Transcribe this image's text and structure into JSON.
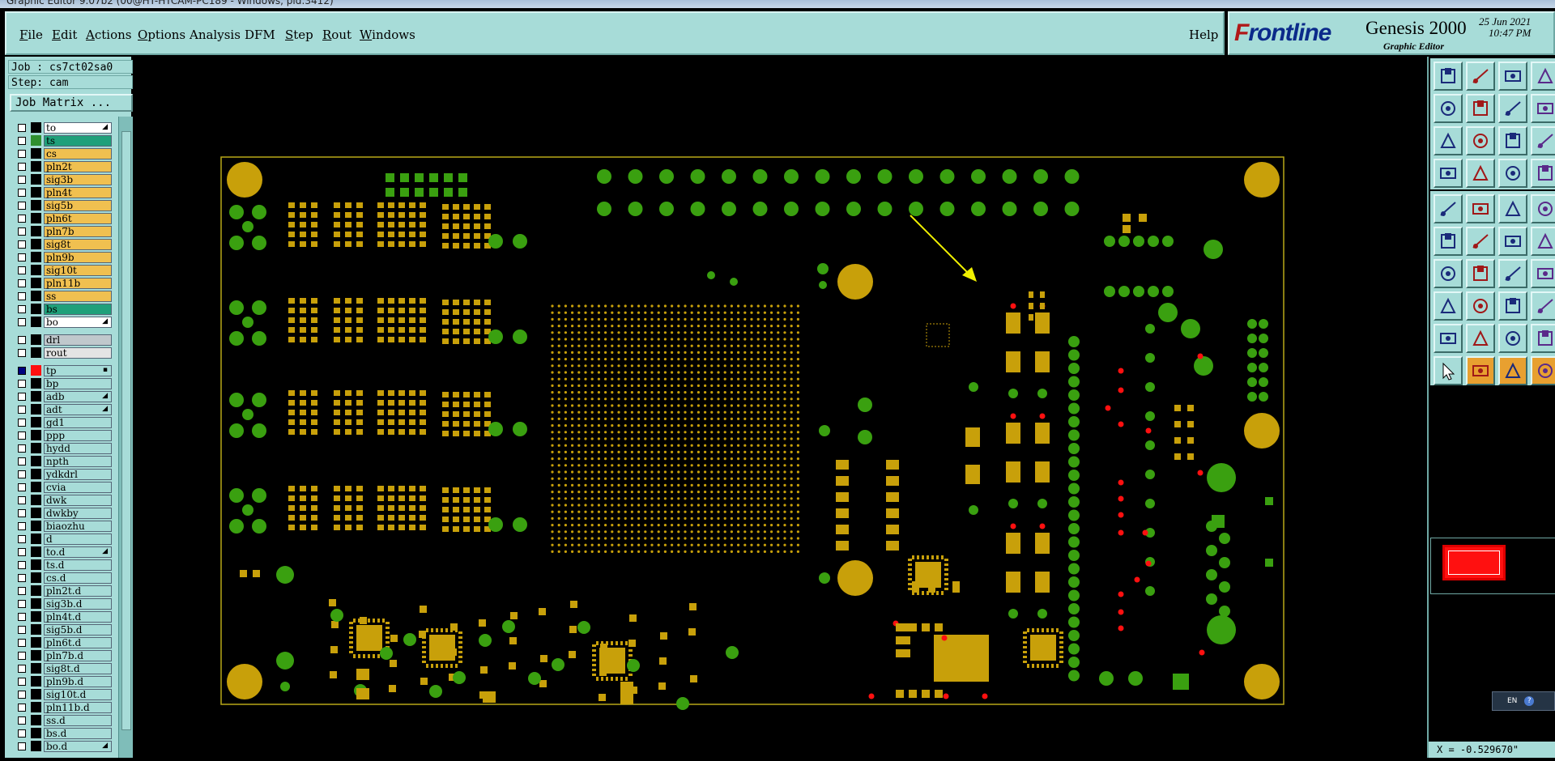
{
  "window": {
    "title": "Graphic Editor 9.07b2 (00@HT-HTCAM-PC189 - Windows, pid:3412)"
  },
  "menubar": {
    "items": [
      {
        "label": "File",
        "u": "F",
        "rest": "ile"
      },
      {
        "label": "Edit",
        "u": "E",
        "rest": "dit"
      },
      {
        "label": "Actions",
        "u": "A",
        "rest": "ctions"
      },
      {
        "label": "Options",
        "u": "O",
        "rest": "ptions"
      },
      {
        "label": "Analysis",
        "u": "",
        "rest": "Analysis"
      },
      {
        "label": "DFM",
        "u": "",
        "rest": "DFM"
      },
      {
        "label": "Step",
        "u": "S",
        "rest": "tep"
      },
      {
        "label": "Rout",
        "u": "R",
        "rest": "out"
      },
      {
        "label": "Windows",
        "u": "W",
        "rest": "indows"
      }
    ],
    "help": "Help"
  },
  "brand": {
    "logo_first": "F",
    "logo_rest": "rontline",
    "product": "Genesis 2000",
    "subtitle": "Graphic Editor",
    "date": "25 Jun 2021",
    "time": "10:47 PM"
  },
  "job": {
    "job_label": "Job : cs7ct02sa0",
    "step_label": "Step: cam",
    "matrix_button": "Job Matrix ..."
  },
  "layers": [
    {
      "name": "to",
      "bg": "#ffffff",
      "swatch": "#000000",
      "flag": "◢"
    },
    {
      "name": "ts",
      "bg": "#1fa07a",
      "swatch": "#2f8f2f",
      "flag": ""
    },
    {
      "name": "cs",
      "bg": "#f0c050",
      "swatch": "#000000",
      "flag": ""
    },
    {
      "name": "pln2t",
      "bg": "#f0c050",
      "swatch": "#000000",
      "flag": ""
    },
    {
      "name": "sig3b",
      "bg": "#f0c050",
      "swatch": "#000000",
      "flag": ""
    },
    {
      "name": "pln4t",
      "bg": "#f0c050",
      "swatch": "#000000",
      "flag": ""
    },
    {
      "name": "sig5b",
      "bg": "#f0c050",
      "swatch": "#000000",
      "flag": ""
    },
    {
      "name": "pln6t",
      "bg": "#f0c050",
      "swatch": "#000000",
      "flag": ""
    },
    {
      "name": "pln7b",
      "bg": "#f0c050",
      "swatch": "#000000",
      "flag": ""
    },
    {
      "name": "sig8t",
      "bg": "#f0c050",
      "swatch": "#000000",
      "flag": ""
    },
    {
      "name": "pln9b",
      "bg": "#f0c050",
      "swatch": "#000000",
      "flag": ""
    },
    {
      "name": "sig10t",
      "bg": "#f0c050",
      "swatch": "#000000",
      "flag": ""
    },
    {
      "name": "pln11b",
      "bg": "#f0c050",
      "swatch": "#000000",
      "flag": ""
    },
    {
      "name": "ss",
      "bg": "#f0c050",
      "swatch": "#000000",
      "flag": ""
    },
    {
      "name": "bs",
      "bg": "#1fa07a",
      "swatch": "#000000",
      "flag": ""
    },
    {
      "name": "bo",
      "bg": "#ffffff",
      "swatch": "#000000",
      "flag": "◢"
    },
    {
      "name": "drl",
      "bg": "#c0c8cc",
      "swatch": "#000000",
      "flag": ""
    },
    {
      "name": "rout",
      "bg": "#e4e4e4",
      "swatch": "#000000",
      "flag": ""
    },
    {
      "name": "tp",
      "bg": "#a7dcd8",
      "swatch": "#ff1010",
      "flag": "▪"
    },
    {
      "name": "bp",
      "bg": "#a7dcd8",
      "swatch": "#000000",
      "flag": ""
    },
    {
      "name": "adb",
      "bg": "#a7dcd8",
      "swatch": "#000000",
      "flag": "◢"
    },
    {
      "name": "adt",
      "bg": "#a7dcd8",
      "swatch": "#000000",
      "flag": "◢"
    },
    {
      "name": "gd1",
      "bg": "#a7dcd8",
      "swatch": "#000000",
      "flag": ""
    },
    {
      "name": "ppp",
      "bg": "#a7dcd8",
      "swatch": "#000000",
      "flag": ""
    },
    {
      "name": "hydd",
      "bg": "#a7dcd8",
      "swatch": "#000000",
      "flag": ""
    },
    {
      "name": "npth",
      "bg": "#a7dcd8",
      "swatch": "#000000",
      "flag": ""
    },
    {
      "name": "ydkdrl",
      "bg": "#a7dcd8",
      "swatch": "#000000",
      "flag": ""
    },
    {
      "name": "cvia",
      "bg": "#a7dcd8",
      "swatch": "#000000",
      "flag": ""
    },
    {
      "name": "dwk",
      "bg": "#a7dcd8",
      "swatch": "#000000",
      "flag": ""
    },
    {
      "name": "dwkby",
      "bg": "#a7dcd8",
      "swatch": "#000000",
      "flag": ""
    },
    {
      "name": "biaozhu",
      "bg": "#a7dcd8",
      "swatch": "#000000",
      "flag": ""
    },
    {
      "name": "d",
      "bg": "#a7dcd8",
      "swatch": "#000000",
      "flag": ""
    },
    {
      "name": "to.d",
      "bg": "#a7dcd8",
      "swatch": "#000000",
      "flag": "◢"
    },
    {
      "name": "ts.d",
      "bg": "#a7dcd8",
      "swatch": "#000000",
      "flag": ""
    },
    {
      "name": "cs.d",
      "bg": "#a7dcd8",
      "swatch": "#000000",
      "flag": ""
    },
    {
      "name": "pln2t.d",
      "bg": "#a7dcd8",
      "swatch": "#000000",
      "flag": ""
    },
    {
      "name": "sig3b.d",
      "bg": "#a7dcd8",
      "swatch": "#000000",
      "flag": ""
    },
    {
      "name": "pln4t.d",
      "bg": "#a7dcd8",
      "swatch": "#000000",
      "flag": ""
    },
    {
      "name": "sig5b.d",
      "bg": "#a7dcd8",
      "swatch": "#000000",
      "flag": ""
    },
    {
      "name": "pln6t.d",
      "bg": "#a7dcd8",
      "swatch": "#000000",
      "flag": ""
    },
    {
      "name": "pln7b.d",
      "bg": "#a7dcd8",
      "swatch": "#000000",
      "flag": ""
    },
    {
      "name": "sig8t.d",
      "bg": "#a7dcd8",
      "swatch": "#000000",
      "flag": ""
    },
    {
      "name": "pln9b.d",
      "bg": "#a7dcd8",
      "swatch": "#000000",
      "flag": ""
    },
    {
      "name": "sig10t.d",
      "bg": "#a7dcd8",
      "swatch": "#000000",
      "flag": ""
    },
    {
      "name": "pln11b.d",
      "bg": "#a7dcd8",
      "swatch": "#000000",
      "flag": ""
    },
    {
      "name": "ss.d",
      "bg": "#a7dcd8",
      "swatch": "#000000",
      "flag": ""
    },
    {
      "name": "bs.d",
      "bg": "#a7dcd8",
      "swatch": "#000000",
      "flag": ""
    },
    {
      "name": "bo.d",
      "bg": "#a7dcd8",
      "swatch": "#000000",
      "flag": "◢"
    }
  ],
  "status": {
    "coordinate": "X = -0.529670\"",
    "lang": "EN"
  },
  "colors": {
    "panel": "#a7dcd8",
    "pad_yellow": "#c8a00a",
    "pad_green": "#3aa010",
    "marker_red": "#ff1010",
    "arrow_yellow": "#f0f000"
  },
  "tools": [
    "open-step-icon",
    "save-step-icon",
    "home-icon",
    "window-layout-icon",
    "zoom-in-icon",
    "zoom-out-icon",
    "pan-icon",
    "redraw-icon",
    "zoom-home-icon",
    "zoom-fit-icon",
    "scale-1-2-icon",
    "help-query-icon",
    "snap-icon",
    "measure-icon",
    "net-icon",
    "select-net-icon",
    "pad-icon",
    "shape-icon",
    "line-icon",
    "circle-icon",
    "select-net-blue-icon",
    "delete-feature-icon",
    "move-icon",
    "route-icon",
    "add-line-icon",
    "cut-icon",
    "arc-icon",
    "pair-icon",
    "copy-icon",
    "resize-icon",
    "connect-icon",
    "group-icon",
    "mirror-icon",
    "rotate-icon",
    "transform-icon",
    "polygon-icon",
    "select-arrow-icon",
    "select-orange-icon",
    "select-box-icon",
    "edit-route-icon"
  ]
}
